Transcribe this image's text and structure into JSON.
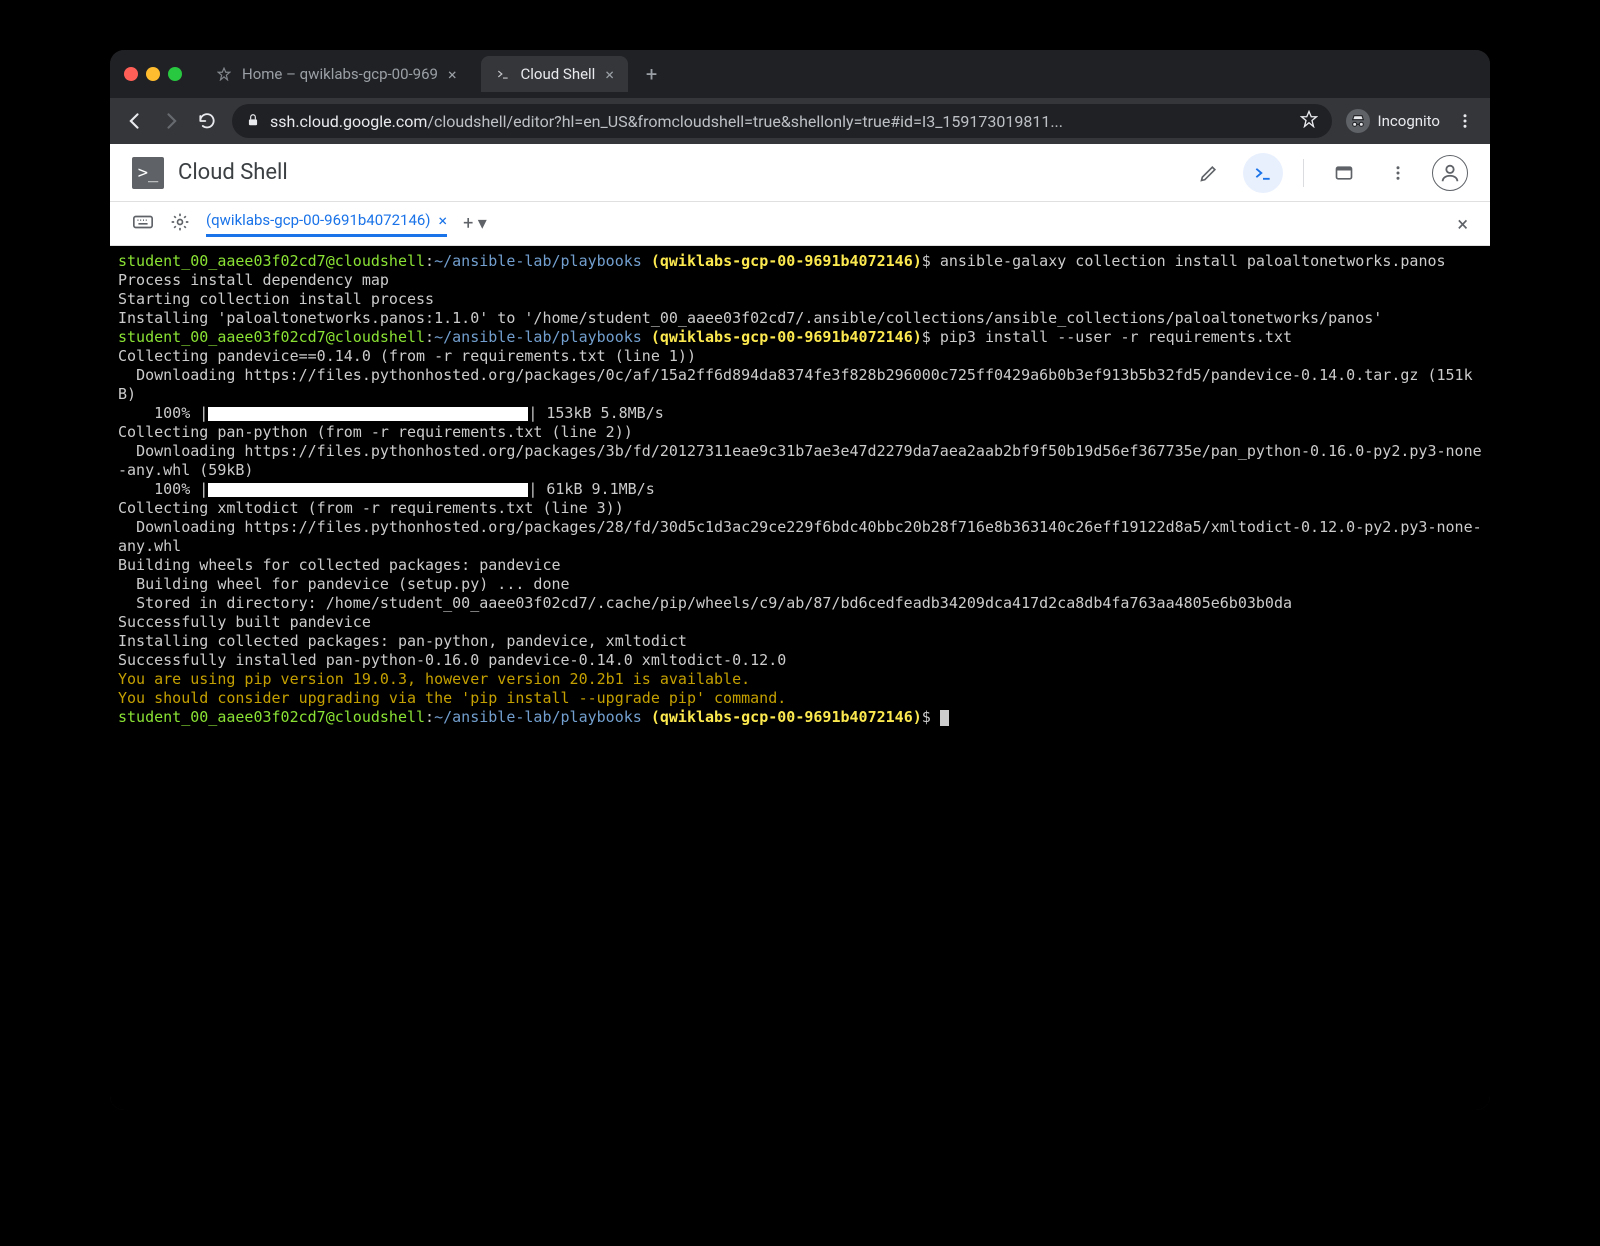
{
  "browser": {
    "tabs": [
      {
        "title": "Home – qwiklabs-gcp-00-969",
        "active": false
      },
      {
        "title": "Cloud Shell",
        "active": true
      }
    ],
    "url_domain": "ssh.cloud.google.com",
    "url_path": "/cloudshell/editor?hl=en_US&fromcloudshell=true&shellonly=true#id=I3_159173019811...",
    "incognito_label": "Incognito"
  },
  "cloudshell": {
    "title": "Cloud Shell",
    "tab_label": "(qwiklabs-gcp-00-9691b4072146)"
  },
  "prompt": {
    "user_host": "student_00_aaee03f02cd7@cloudshell",
    "path": "~/ansible-lab/playbooks",
    "project": "(qwiklabs-gcp-00-9691b4072146)",
    "dollar": "$"
  },
  "cmd1": "ansible-galaxy collection install paloaltonetworks.panos",
  "out1": [
    "Process install dependency map",
    "Starting collection install process",
    "Installing 'paloaltonetworks.panos:1.1.0' to '/home/student_00_aaee03f02cd7/.ansible/collections/ansible_collections/paloaltonetworks/panos'"
  ],
  "cmd2": "pip3 install --user -r requirements.txt",
  "collect1": "Collecting pandevice==0.14.0 (from -r requirements.txt (line 1))",
  "dl1": "  Downloading https://files.pythonhosted.org/packages/0c/af/15a2ff6d894da8374fe3f828b296000c725ff0429a6b0b3ef913b5b32fd5/pandevice-0.14.0.tar.gz (151kB)",
  "prog1": {
    "pct": "    100% |",
    "suffix": "| 153kB 5.8MB/s"
  },
  "collect2": "Collecting pan-python (from -r requirements.txt (line 2))",
  "dl2": "  Downloading https://files.pythonhosted.org/packages/3b/fd/20127311eae9c31b7ae3e47d2279da7aea2aab2bf9f50b19d56ef367735e/pan_python-0.16.0-py2.py3-none-any.whl (59kB)",
  "prog2": {
    "pct": "    100% |",
    "suffix": "| 61kB 9.1MB/s"
  },
  "collect3": "Collecting xmltodict (from -r requirements.txt (line 3))",
  "dl3": "  Downloading https://files.pythonhosted.org/packages/28/fd/30d5c1d3ac29ce229f6bdc40bbc20b28f716e8b363140c26eff19122d8a5/xmltodict-0.12.0-py2.py3-none-any.whl",
  "build": [
    "Building wheels for collected packages: pandevice",
    "  Building wheel for pandevice (setup.py) ... done",
    "  Stored in directory: /home/student_00_aaee03f02cd7/.cache/pip/wheels/c9/ab/87/bd6cedfeadb34209dca417d2ca8db4fa763aa4805e6b03b0da",
    "Successfully built pandevice",
    "Installing collected packages: pan-python, pandevice, xmltodict",
    "Successfully installed pan-python-0.16.0 pandevice-0.14.0 xmltodict-0.12.0"
  ],
  "warn": [
    "You are using pip version 19.0.3, however version 20.2b1 is available.",
    "You should consider upgrading via the 'pip install --upgrade pip' command."
  ]
}
